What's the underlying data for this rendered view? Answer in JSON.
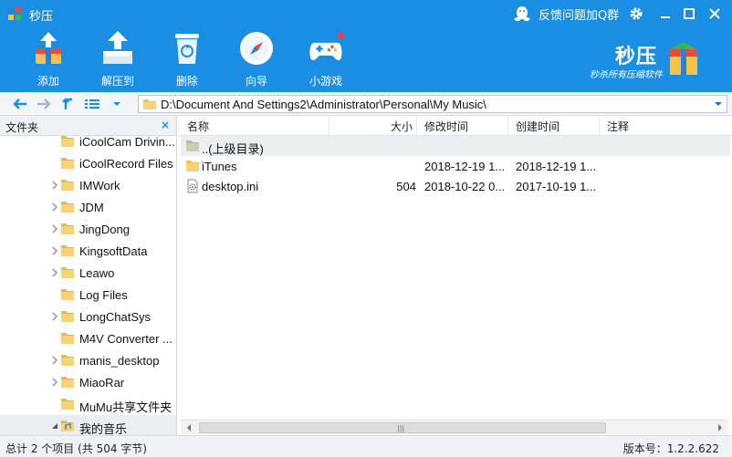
{
  "window": {
    "title": "秒压",
    "feedback_label": "反馈问题加Q群"
  },
  "toolbar": {
    "items": [
      {
        "label": "添加",
        "icon": "add-archive-icon"
      },
      {
        "label": "解压到",
        "icon": "extract-icon"
      },
      {
        "label": "删除",
        "icon": "recycle-bin-icon"
      },
      {
        "label": "向导",
        "icon": "compass-icon"
      },
      {
        "label": "小游戏",
        "icon": "gamepad-icon"
      }
    ]
  },
  "brand": {
    "name": "秒压",
    "slogan": "秒杀所有压缩软件"
  },
  "navbar": {
    "path": "D:\\Document And Settings2\\Administrator\\Personal\\My Music\\"
  },
  "sidebar": {
    "title": "文件夹",
    "close": "×",
    "items": [
      {
        "label": "iCoolCam Drivin...",
        "arrow": "none"
      },
      {
        "label": "iCoolRecord Files",
        "arrow": "none"
      },
      {
        "label": "IMWork",
        "arrow": "collapsed"
      },
      {
        "label": "JDM",
        "arrow": "collapsed"
      },
      {
        "label": "JingDong",
        "arrow": "collapsed"
      },
      {
        "label": "KingsoftData",
        "arrow": "collapsed"
      },
      {
        "label": "Leawo",
        "arrow": "collapsed"
      },
      {
        "label": "Log Files",
        "arrow": "none"
      },
      {
        "label": "LongChatSys",
        "arrow": "collapsed"
      },
      {
        "label": "M4V Converter ...",
        "arrow": "none"
      },
      {
        "label": "manis_desktop",
        "arrow": "collapsed"
      },
      {
        "label": "MiaoRar",
        "arrow": "collapsed"
      },
      {
        "label": "MuMu共享文件夹",
        "arrow": "none"
      },
      {
        "label": "我的音乐",
        "arrow": "expanded"
      }
    ]
  },
  "filelist": {
    "columns": {
      "name": "名称",
      "size": "大小",
      "modified": "修改时间",
      "created": "创建时间",
      "comment": "注释"
    },
    "rows": [
      {
        "name": "..(上级目录)",
        "size": "",
        "modified": "",
        "created": "",
        "icon": "parent-folder-icon"
      },
      {
        "name": "iTunes",
        "size": "",
        "modified": "2018-12-19 1...",
        "created": "2018-12-19 1...",
        "icon": "folder-icon"
      },
      {
        "name": "desktop.ini",
        "size": "504",
        "modified": "2018-10-22 0...",
        "created": "2017-10-19 1...",
        "icon": "ini-file-icon"
      }
    ],
    "scroll_grip": "|||"
  },
  "status": {
    "summary": "总计 2 个项目 (共 504 字节)",
    "version": "版本号：1.2.2.622"
  },
  "colors": {
    "header_blue": "#1a8ee3",
    "folder_yellow": "#f2c14e",
    "notification_red": "#ff3b30"
  }
}
